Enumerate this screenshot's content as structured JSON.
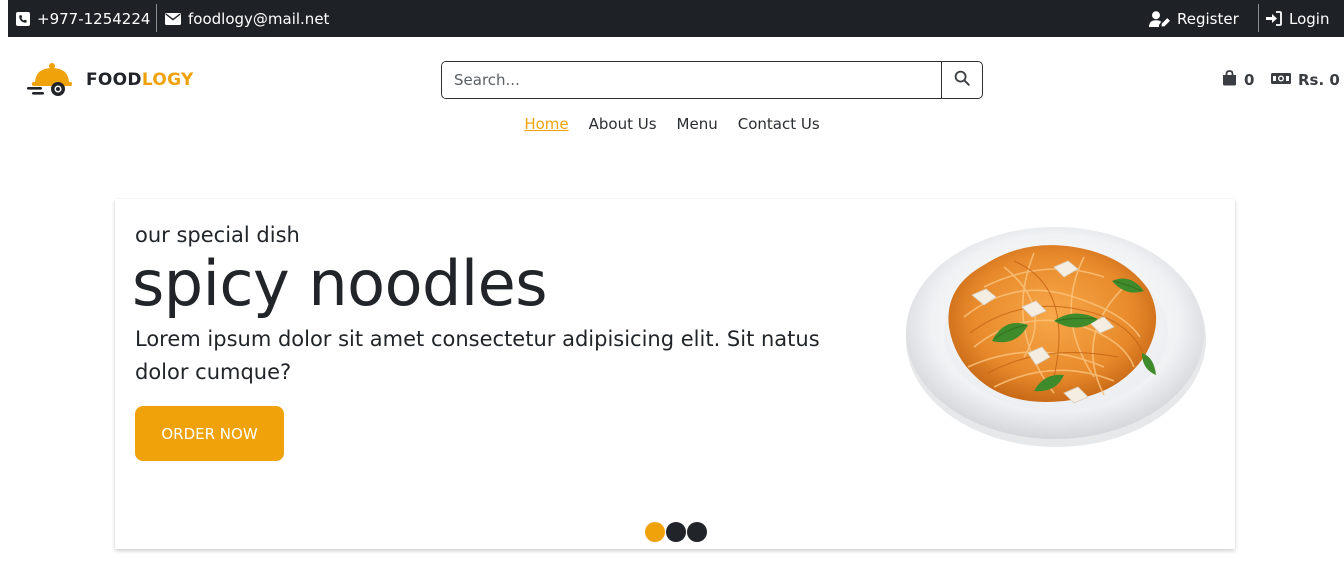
{
  "topbar": {
    "phone": "+977-1254224",
    "email": "foodlogy@mail.net",
    "register": "Register",
    "login": "Login",
    "icons": {
      "phone": "phone-square-icon",
      "email": "envelope-icon",
      "register": "user-edit-icon",
      "login": "sign-in-icon"
    }
  },
  "header": {
    "logo": {
      "part1": "FOOD",
      "part2": "LOGY",
      "icon": "cloche-delivery-icon"
    },
    "search": {
      "placeholder": "Search...",
      "value": ""
    },
    "cart": {
      "count": "0",
      "amount": "Rs. 0"
    }
  },
  "nav": {
    "items": [
      {
        "label": "Home",
        "active": true
      },
      {
        "label": "About Us",
        "active": false
      },
      {
        "label": "Menu",
        "active": false
      },
      {
        "label": "Contact Us",
        "active": false
      }
    ]
  },
  "hero": {
    "eyebrow": "our special dish",
    "headline": "spicy noodles",
    "description": "Lorem ipsum dolor sit amet consectetur adipisicing elit. Sit natus dolor cumque?",
    "button": "ORDER NOW",
    "slide_count": 3,
    "active_slide": 1
  },
  "colors": {
    "accent": "#f0a20a",
    "topbar": "#1e2125",
    "text": "#212529"
  }
}
